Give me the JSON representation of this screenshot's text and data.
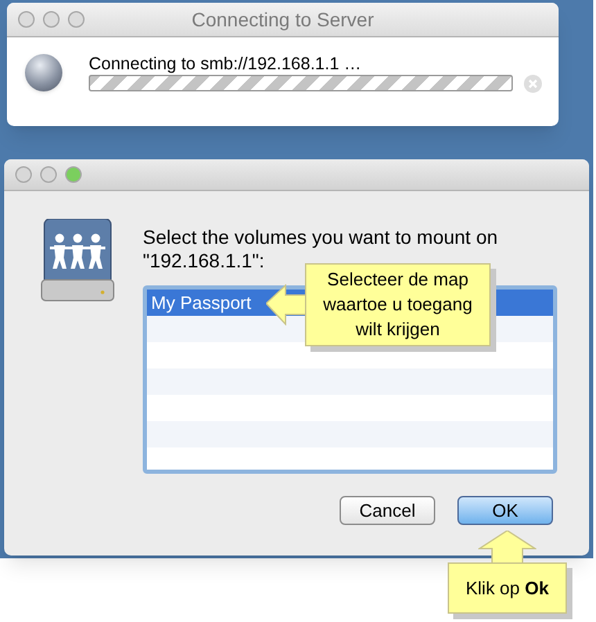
{
  "windows": [
    {
      "title": "Connecting to Server",
      "active": false,
      "message": "Connecting to smb://192.168.1.1 …",
      "progress": {
        "indeterminate": true
      }
    },
    {
      "active": true,
      "prompt": "Select the volumes you want to mount on \"192.168.1.1\":",
      "volumes": [
        {
          "name": "My Passport",
          "selected": true
        }
      ],
      "buttons": [
        {
          "label": "Cancel",
          "default": false
        },
        {
          "label": "OK",
          "default": true
        }
      ]
    }
  ],
  "callouts": [
    {
      "text": "Selecteer de map waartoe u toegang wilt krijgen",
      "kind": "side"
    },
    {
      "text": "Klik op **Ok**",
      "kind": "below"
    }
  ]
}
